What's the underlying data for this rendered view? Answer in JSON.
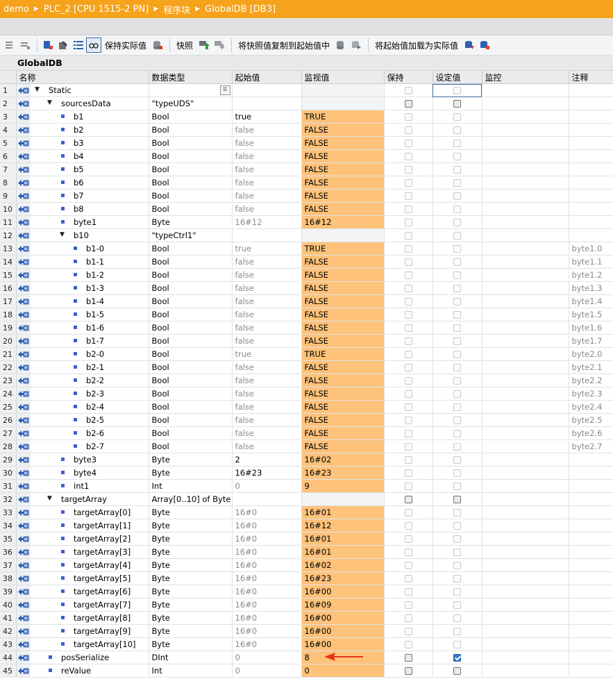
{
  "breadcrumb": [
    "demo",
    "PLC_2 [CPU 1515-2 PN]",
    "程序块",
    "GlobalDB [DB3]"
  ],
  "toolbar": {
    "keep_actual_label": "保持实际值",
    "snapshot_label": "快照",
    "copy_snapshot_label": "将快照值复制到起始值中",
    "load_start_label": "将起始值加载为实际值"
  },
  "db_title": "GlobalDB",
  "columns": {
    "name": "名称",
    "datatype": "数据类型",
    "start": "起始值",
    "monitor": "监视值",
    "retain": "保持",
    "setpoint": "设定值",
    "monitoring": "监控",
    "comment": "注释"
  },
  "rows": [
    {
      "n": "1",
      "name": "Static",
      "level": 0,
      "expand": "down",
      "dt": "",
      "sv": "",
      "mv": "",
      "grey": false,
      "retain": "light",
      "set": "light",
      "cm": "",
      "mark": "none"
    },
    {
      "n": "2",
      "name": "sourcesData",
      "level": 1,
      "expand": "down",
      "dt": "\"typeUDS\"",
      "sv": "",
      "mv": "",
      "grey": false,
      "retain": "dark",
      "set": "dark",
      "cm": "",
      "mark": "sq"
    },
    {
      "n": "3",
      "name": "b1",
      "level": 2,
      "dt": "Bool",
      "sv": "true",
      "mv": "TRUE",
      "grey": false,
      "retain": "light",
      "set": "light",
      "cm": ""
    },
    {
      "n": "4",
      "name": "b2",
      "level": 2,
      "dt": "Bool",
      "sv": "false",
      "mv": "FALSE",
      "grey": true,
      "retain": "light",
      "set": "light",
      "cm": ""
    },
    {
      "n": "5",
      "name": "b3",
      "level": 2,
      "dt": "Bool",
      "sv": "false",
      "mv": "FALSE",
      "grey": true,
      "retain": "light",
      "set": "light",
      "cm": ""
    },
    {
      "n": "6",
      "name": "b4",
      "level": 2,
      "dt": "Bool",
      "sv": "false",
      "mv": "FALSE",
      "grey": true,
      "retain": "light",
      "set": "light",
      "cm": ""
    },
    {
      "n": "7",
      "name": "b5",
      "level": 2,
      "dt": "Bool",
      "sv": "false",
      "mv": "FALSE",
      "grey": true,
      "retain": "light",
      "set": "light",
      "cm": ""
    },
    {
      "n": "8",
      "name": "b6",
      "level": 2,
      "dt": "Bool",
      "sv": "false",
      "mv": "FALSE",
      "grey": true,
      "retain": "light",
      "set": "light",
      "cm": ""
    },
    {
      "n": "9",
      "name": "b7",
      "level": 2,
      "dt": "Bool",
      "sv": "false",
      "mv": "FALSE",
      "grey": true,
      "retain": "light",
      "set": "light",
      "cm": ""
    },
    {
      "n": "10",
      "name": "b8",
      "level": 2,
      "dt": "Bool",
      "sv": "false",
      "mv": "FALSE",
      "grey": true,
      "retain": "light",
      "set": "light",
      "cm": ""
    },
    {
      "n": "11",
      "name": "byte1",
      "level": 2,
      "dt": "Byte",
      "sv": "16#12",
      "mv": "16#12",
      "grey": true,
      "retain": "light",
      "set": "light",
      "cm": ""
    },
    {
      "n": "12",
      "name": "b10",
      "level": 2,
      "expand": "down",
      "dt": "\"typeCtrl1\"",
      "sv": "",
      "mv": "",
      "grey": false,
      "retain": "light",
      "set": "light",
      "cm": ""
    },
    {
      "n": "13",
      "name": "b1-0",
      "level": 3,
      "dt": "Bool",
      "sv": "true",
      "mv": "TRUE",
      "grey": true,
      "retain": "light",
      "set": "light",
      "cm": "byte1.0"
    },
    {
      "n": "14",
      "name": "b1-1",
      "level": 3,
      "dt": "Bool",
      "sv": "false",
      "mv": "FALSE",
      "grey": true,
      "retain": "light",
      "set": "light",
      "cm": "byte1.1"
    },
    {
      "n": "15",
      "name": "b1-2",
      "level": 3,
      "dt": "Bool",
      "sv": "false",
      "mv": "FALSE",
      "grey": true,
      "retain": "light",
      "set": "light",
      "cm": "byte1.2"
    },
    {
      "n": "16",
      "name": "b1-3",
      "level": 3,
      "dt": "Bool",
      "sv": "false",
      "mv": "FALSE",
      "grey": true,
      "retain": "light",
      "set": "light",
      "cm": "byte1.3"
    },
    {
      "n": "17",
      "name": "b1-4",
      "level": 3,
      "dt": "Bool",
      "sv": "false",
      "mv": "FALSE",
      "grey": true,
      "retain": "light",
      "set": "light",
      "cm": "byte1.4"
    },
    {
      "n": "18",
      "name": "b1-5",
      "level": 3,
      "dt": "Bool",
      "sv": "false",
      "mv": "FALSE",
      "grey": true,
      "retain": "light",
      "set": "light",
      "cm": "byte1.5"
    },
    {
      "n": "19",
      "name": "b1-6",
      "level": 3,
      "dt": "Bool",
      "sv": "false",
      "mv": "FALSE",
      "grey": true,
      "retain": "light",
      "set": "light",
      "cm": "byte1.6"
    },
    {
      "n": "20",
      "name": "b1-7",
      "level": 3,
      "dt": "Bool",
      "sv": "false",
      "mv": "FALSE",
      "grey": true,
      "retain": "light",
      "set": "light",
      "cm": "byte1.7"
    },
    {
      "n": "21",
      "name": "b2-0",
      "level": 3,
      "dt": "Bool",
      "sv": "true",
      "mv": "TRUE",
      "grey": true,
      "retain": "light",
      "set": "light",
      "cm": "byte2.0"
    },
    {
      "n": "22",
      "name": "b2-1",
      "level": 3,
      "dt": "Bool",
      "sv": "false",
      "mv": "FALSE",
      "grey": true,
      "retain": "light",
      "set": "light",
      "cm": "byte2.1"
    },
    {
      "n": "23",
      "name": "b2-2",
      "level": 3,
      "dt": "Bool",
      "sv": "false",
      "mv": "FALSE",
      "grey": true,
      "retain": "light",
      "set": "light",
      "cm": "byte2.2"
    },
    {
      "n": "24",
      "name": "b2-3",
      "level": 3,
      "dt": "Bool",
      "sv": "false",
      "mv": "FALSE",
      "grey": true,
      "retain": "light",
      "set": "light",
      "cm": "byte2.3"
    },
    {
      "n": "25",
      "name": "b2-4",
      "level": 3,
      "dt": "Bool",
      "sv": "false",
      "mv": "FALSE",
      "grey": true,
      "retain": "light",
      "set": "light",
      "cm": "byte2.4"
    },
    {
      "n": "26",
      "name": "b2-5",
      "level": 3,
      "dt": "Bool",
      "sv": "false",
      "mv": "FALSE",
      "grey": true,
      "retain": "light",
      "set": "light",
      "cm": "byte2.5"
    },
    {
      "n": "27",
      "name": "b2-6",
      "level": 3,
      "dt": "Bool",
      "sv": "false",
      "mv": "FALSE",
      "grey": true,
      "retain": "light",
      "set": "light",
      "cm": "byte2.6"
    },
    {
      "n": "28",
      "name": "b2-7",
      "level": 3,
      "dt": "Bool",
      "sv": "false",
      "mv": "FALSE",
      "grey": true,
      "retain": "light",
      "set": "light",
      "cm": "byte2.7"
    },
    {
      "n": "29",
      "name": "byte3",
      "level": 2,
      "dt": "Byte",
      "sv": "2",
      "mv": "16#02",
      "grey": false,
      "retain": "light",
      "set": "light",
      "cm": ""
    },
    {
      "n": "30",
      "name": "byte4",
      "level": 2,
      "dt": "Byte",
      "sv": "16#23",
      "mv": "16#23",
      "grey": false,
      "retain": "light",
      "set": "light",
      "cm": ""
    },
    {
      "n": "31",
      "name": "int1",
      "level": 2,
      "dt": "Int",
      "sv": "0",
      "mv": "9",
      "grey": true,
      "retain": "light",
      "set": "light",
      "cm": ""
    },
    {
      "n": "32",
      "name": "targetArray",
      "level": 1,
      "expand": "down",
      "dt": "Array[0..10] of Byte",
      "sv": "",
      "mv": "",
      "grey": false,
      "retain": "dark",
      "set": "dark",
      "cm": "",
      "mark": "sq"
    },
    {
      "n": "33",
      "name": "targetArray[0]",
      "level": 2,
      "dt": "Byte",
      "sv": "16#0",
      "mv": "16#01",
      "grey": true,
      "retain": "light",
      "set": "light",
      "cm": ""
    },
    {
      "n": "34",
      "name": "targetArray[1]",
      "level": 2,
      "dt": "Byte",
      "sv": "16#0",
      "mv": "16#12",
      "grey": true,
      "retain": "light",
      "set": "light",
      "cm": ""
    },
    {
      "n": "35",
      "name": "targetArray[2]",
      "level": 2,
      "dt": "Byte",
      "sv": "16#0",
      "mv": "16#01",
      "grey": true,
      "retain": "light",
      "set": "light",
      "cm": ""
    },
    {
      "n": "36",
      "name": "targetArray[3]",
      "level": 2,
      "dt": "Byte",
      "sv": "16#0",
      "mv": "16#01",
      "grey": true,
      "retain": "light",
      "set": "light",
      "cm": ""
    },
    {
      "n": "37",
      "name": "targetArray[4]",
      "level": 2,
      "dt": "Byte",
      "sv": "16#0",
      "mv": "16#02",
      "grey": true,
      "retain": "light",
      "set": "light",
      "cm": ""
    },
    {
      "n": "38",
      "name": "targetArray[5]",
      "level": 2,
      "dt": "Byte",
      "sv": "16#0",
      "mv": "16#23",
      "grey": true,
      "retain": "light",
      "set": "light",
      "cm": ""
    },
    {
      "n": "39",
      "name": "targetArray[6]",
      "level": 2,
      "dt": "Byte",
      "sv": "16#0",
      "mv": "16#00",
      "grey": true,
      "retain": "light",
      "set": "light",
      "cm": ""
    },
    {
      "n": "40",
      "name": "targetArray[7]",
      "level": 2,
      "dt": "Byte",
      "sv": "16#0",
      "mv": "16#09",
      "grey": true,
      "retain": "light",
      "set": "light",
      "cm": ""
    },
    {
      "n": "41",
      "name": "targetArray[8]",
      "level": 2,
      "dt": "Byte",
      "sv": "16#0",
      "mv": "16#00",
      "grey": true,
      "retain": "light",
      "set": "light",
      "cm": ""
    },
    {
      "n": "42",
      "name": "targetArray[9]",
      "level": 2,
      "dt": "Byte",
      "sv": "16#0",
      "mv": "16#00",
      "grey": true,
      "retain": "light",
      "set": "light",
      "cm": ""
    },
    {
      "n": "43",
      "name": "targetArray[10]",
      "level": 2,
      "dt": "Byte",
      "sv": "16#0",
      "mv": "16#00",
      "grey": true,
      "retain": "light",
      "set": "light",
      "cm": ""
    },
    {
      "n": "44",
      "name": "posSerialize",
      "level": 1,
      "dt": "DInt",
      "sv": "0",
      "mv": "8",
      "grey": true,
      "retain": "dark",
      "set": "checked",
      "cm": "",
      "mark": "sq",
      "arrow": true
    },
    {
      "n": "45",
      "name": "reValue",
      "level": 1,
      "dt": "Int",
      "sv": "0",
      "mv": "0",
      "grey": true,
      "retain": "dark",
      "set": "dark",
      "cm": "",
      "mark": "sq"
    }
  ],
  "colors": {
    "titlebar": "#f6a21a",
    "monitor_cell": "#fec27a",
    "annotation_arrow": "#e8331c",
    "bullet": "#3a5fcd"
  }
}
